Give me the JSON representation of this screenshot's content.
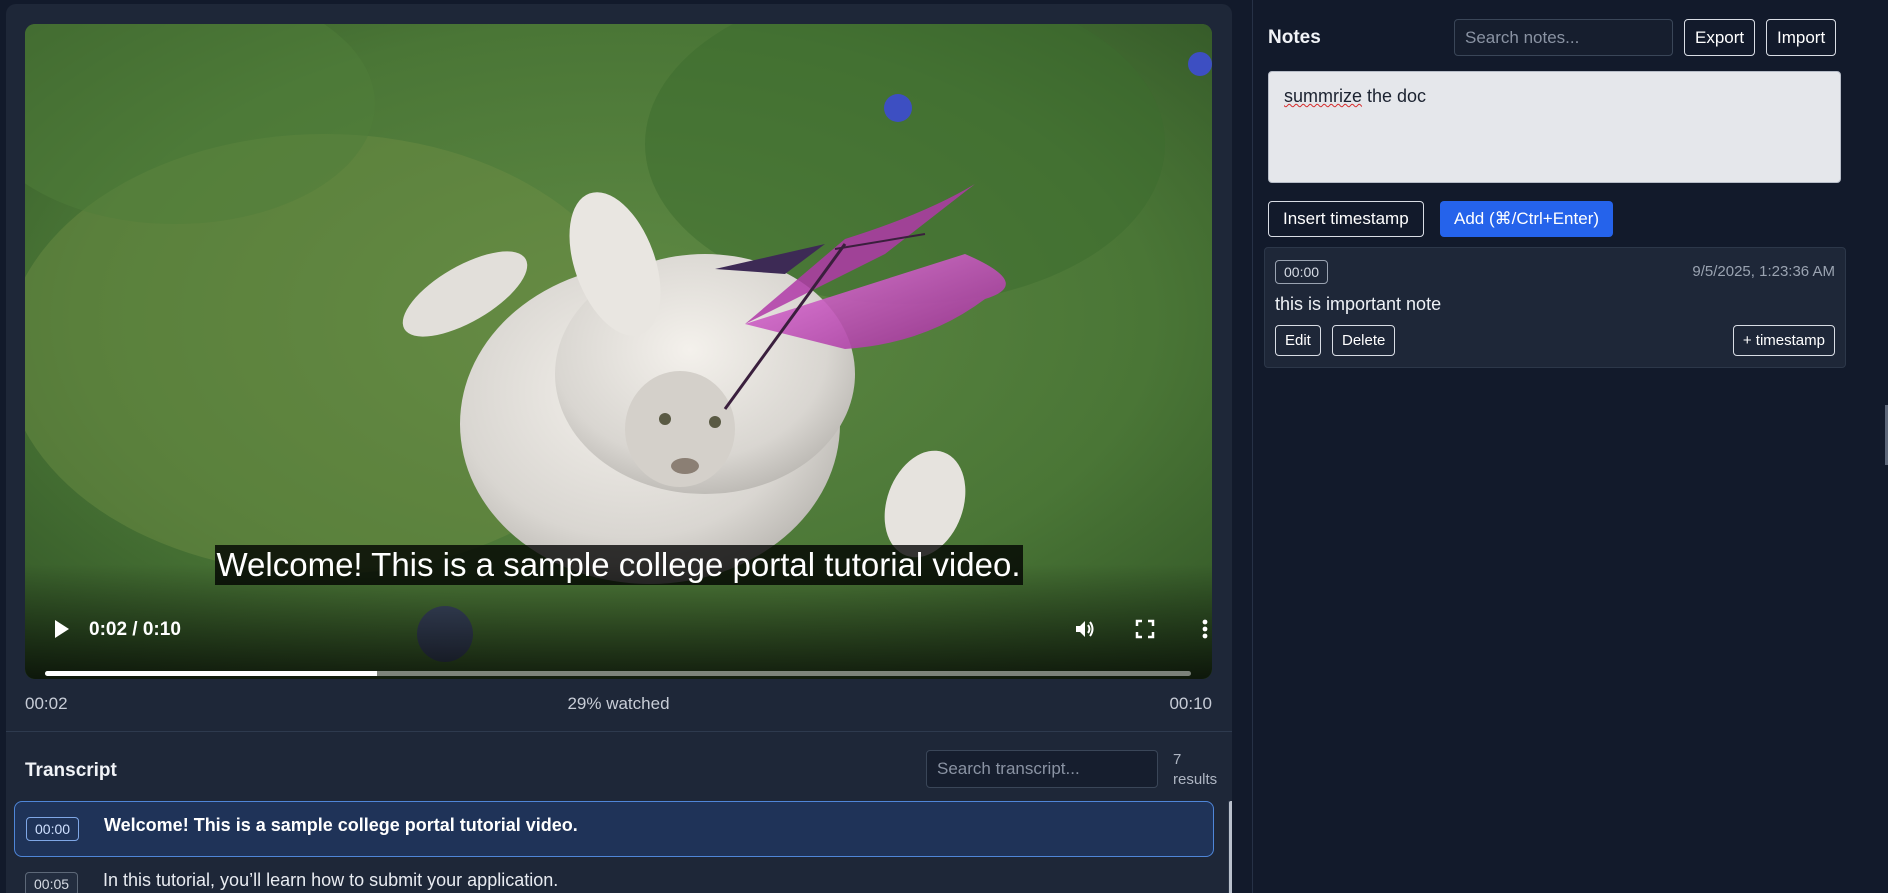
{
  "video": {
    "caption": "Welcome! This is a sample college portal tutorial video.",
    "time_display": "0:02 / 0:10",
    "played_fraction": 0.29,
    "icons": [
      "play-icon",
      "volume-icon",
      "fullscreen-icon",
      "more-options-icon"
    ]
  },
  "progress": {
    "current": "00:02",
    "watched": "29% watched",
    "duration": "00:10"
  },
  "transcript": {
    "title": "Transcript",
    "search_placeholder": "Search transcript...",
    "results_count": "7",
    "results_label": "results",
    "items": [
      {
        "time": "00:00",
        "text": "Welcome! This is a sample college portal tutorial video.",
        "active": true
      },
      {
        "time": "00:05",
        "text": "In this tutorial, you’ll learn how to submit your application.",
        "active": false
      }
    ]
  },
  "notes": {
    "title": "Notes",
    "search_placeholder": "Search notes...",
    "export_label": "Export",
    "import_label": "Import",
    "editor": {
      "word1": "summrize",
      "rest": " the doc"
    },
    "insert_timestamp_label": "Insert timestamp",
    "add_label": "Add (⌘/Ctrl+Enter)",
    "entries": [
      {
        "time": "00:00",
        "date": "9/5/2025, 1:23:36 AM",
        "text": "this is important note",
        "edit_label": "Edit",
        "delete_label": "Delete",
        "timestamp_label": "+ timestamp"
      }
    ]
  },
  "colors": {
    "page_bg": "#121a2b",
    "panel_bg": "#1e2738",
    "accent_blue": "#2563eb",
    "active_row_bg": "#1f3358",
    "active_row_border": "#4f86d8"
  }
}
